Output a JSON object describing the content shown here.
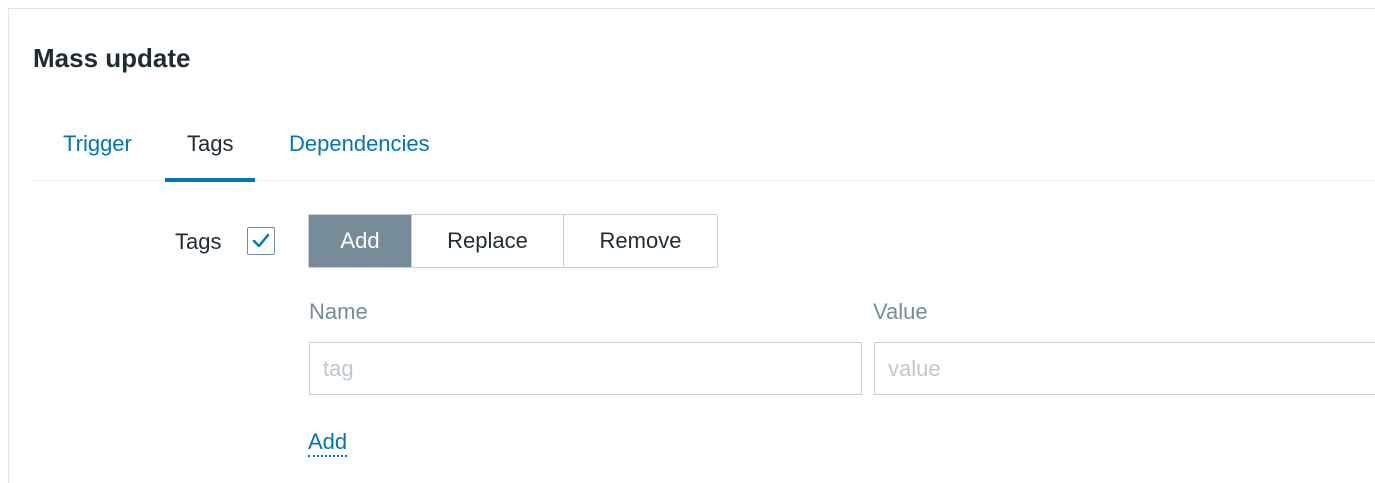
{
  "dialog": {
    "title": "Mass update"
  },
  "tabs": [
    {
      "label": "Trigger",
      "active": false
    },
    {
      "label": "Tags",
      "active": true
    },
    {
      "label": "Dependencies",
      "active": false
    }
  ],
  "tags_field": {
    "label": "Tags",
    "checked": true,
    "modes": [
      {
        "label": "Add",
        "selected": true
      },
      {
        "label": "Replace",
        "selected": false
      },
      {
        "label": "Remove",
        "selected": false
      }
    ],
    "columns": {
      "name": "Name",
      "value": "Value"
    },
    "row": {
      "name_value": "",
      "name_placeholder": "tag",
      "value_value": "",
      "value_placeholder": "value"
    },
    "add_link": "Add"
  },
  "colors": {
    "accent": "#0275b8",
    "selected_segment": "#768d99",
    "muted_text": "#768d99",
    "placeholder": "#bdc8ce",
    "border": "#c8d0d5"
  },
  "icons": {
    "checkbox": "checkmark-icon"
  }
}
